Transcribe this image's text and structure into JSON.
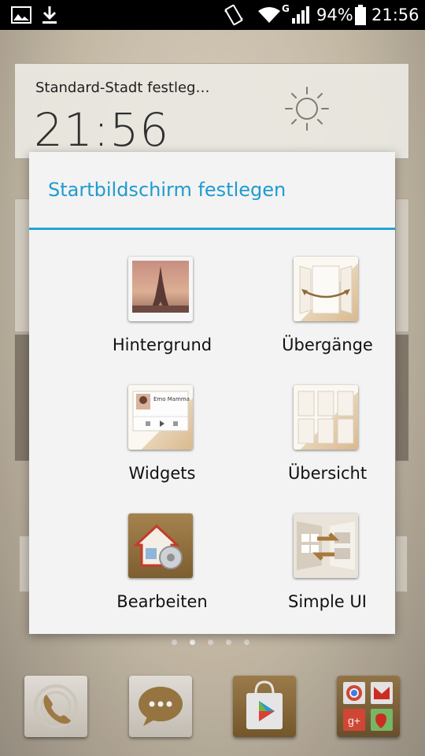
{
  "status_bar": {
    "battery_percent": "94%",
    "time": "21:56",
    "network_type": "G",
    "icons": [
      "image-icon",
      "download-icon",
      "vibrate-icon",
      "wifi-icon",
      "signal-icon",
      "battery-icon"
    ]
  },
  "clock_widget": {
    "city": "Standard-Stadt festleg…",
    "time": "21:56",
    "weather_icon": "sun-icon"
  },
  "dialog": {
    "title": "Startbildschirm festlegen",
    "accent_color": "#1e9bd0",
    "options": [
      {
        "label": "Hintergrund",
        "icon": "wallpaper-icon"
      },
      {
        "label": "Übergänge",
        "icon": "transitions-icon"
      },
      {
        "label": "Widgets",
        "icon": "widgets-icon",
        "preview_text": "Emo Mamma"
      },
      {
        "label": "Übersicht",
        "icon": "overview-icon"
      },
      {
        "label": "Bearbeiten",
        "icon": "edit-home-icon"
      },
      {
        "label": "Simple UI",
        "icon": "simple-ui-icon"
      }
    ]
  },
  "page_indicator": {
    "pages": 5,
    "current": 2
  },
  "dock": {
    "items": [
      {
        "name": "phone",
        "icon": "phone-icon"
      },
      {
        "name": "messaging",
        "icon": "message-icon"
      },
      {
        "name": "play-store",
        "icon": "play-store-icon"
      },
      {
        "name": "google-folder",
        "icon": "google-folder-icon"
      }
    ]
  }
}
